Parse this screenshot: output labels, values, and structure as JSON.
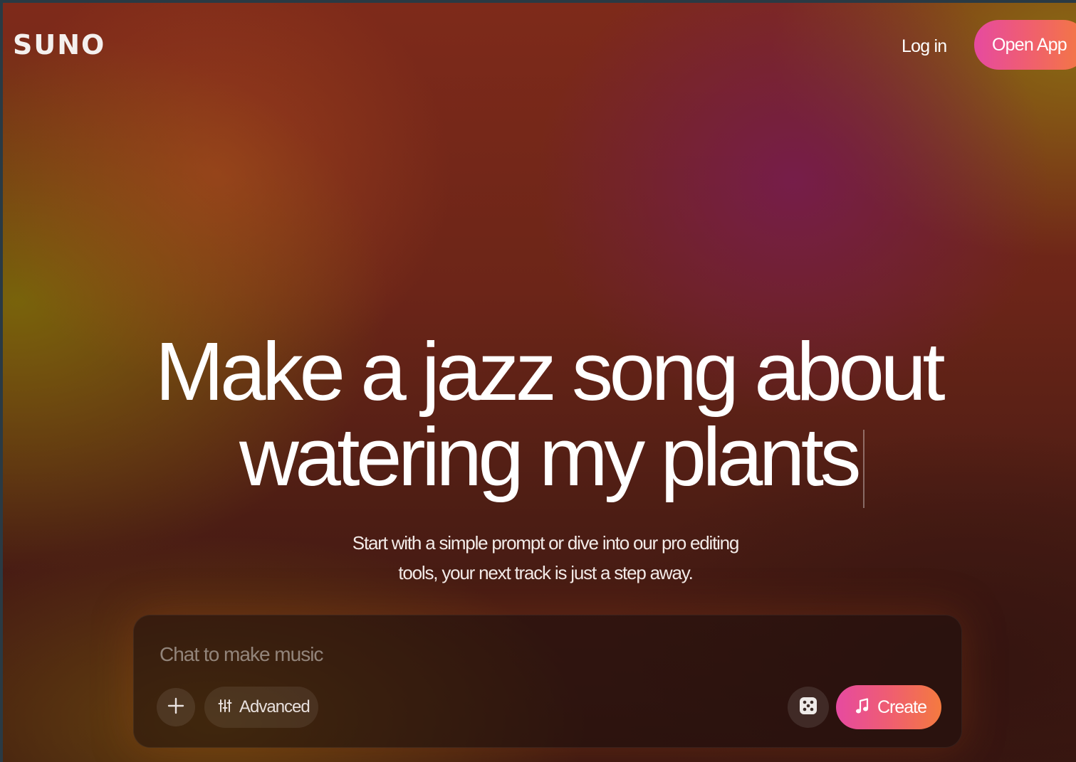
{
  "header": {
    "logo": "SUNO",
    "login_label": "Log in",
    "open_app_label": "Open App"
  },
  "hero": {
    "headline_line1": "Make a jazz song about",
    "headline_line2": "watering my plants",
    "subtitle_line1": "Start with a simple prompt or dive into our pro editing",
    "subtitle_line2": "tools, your next track is just a step away."
  },
  "composer": {
    "placeholder": "Chat to make music",
    "value": "",
    "advanced_label": "Advanced",
    "create_label": "Create"
  },
  "icons": {
    "add": "plus-icon",
    "advanced": "sliders-icon",
    "random": "dice-icon",
    "create": "music-note-icon"
  },
  "colors": {
    "accent_gradient_start": "#e64aa0",
    "accent_gradient_end": "#f47a3f"
  }
}
